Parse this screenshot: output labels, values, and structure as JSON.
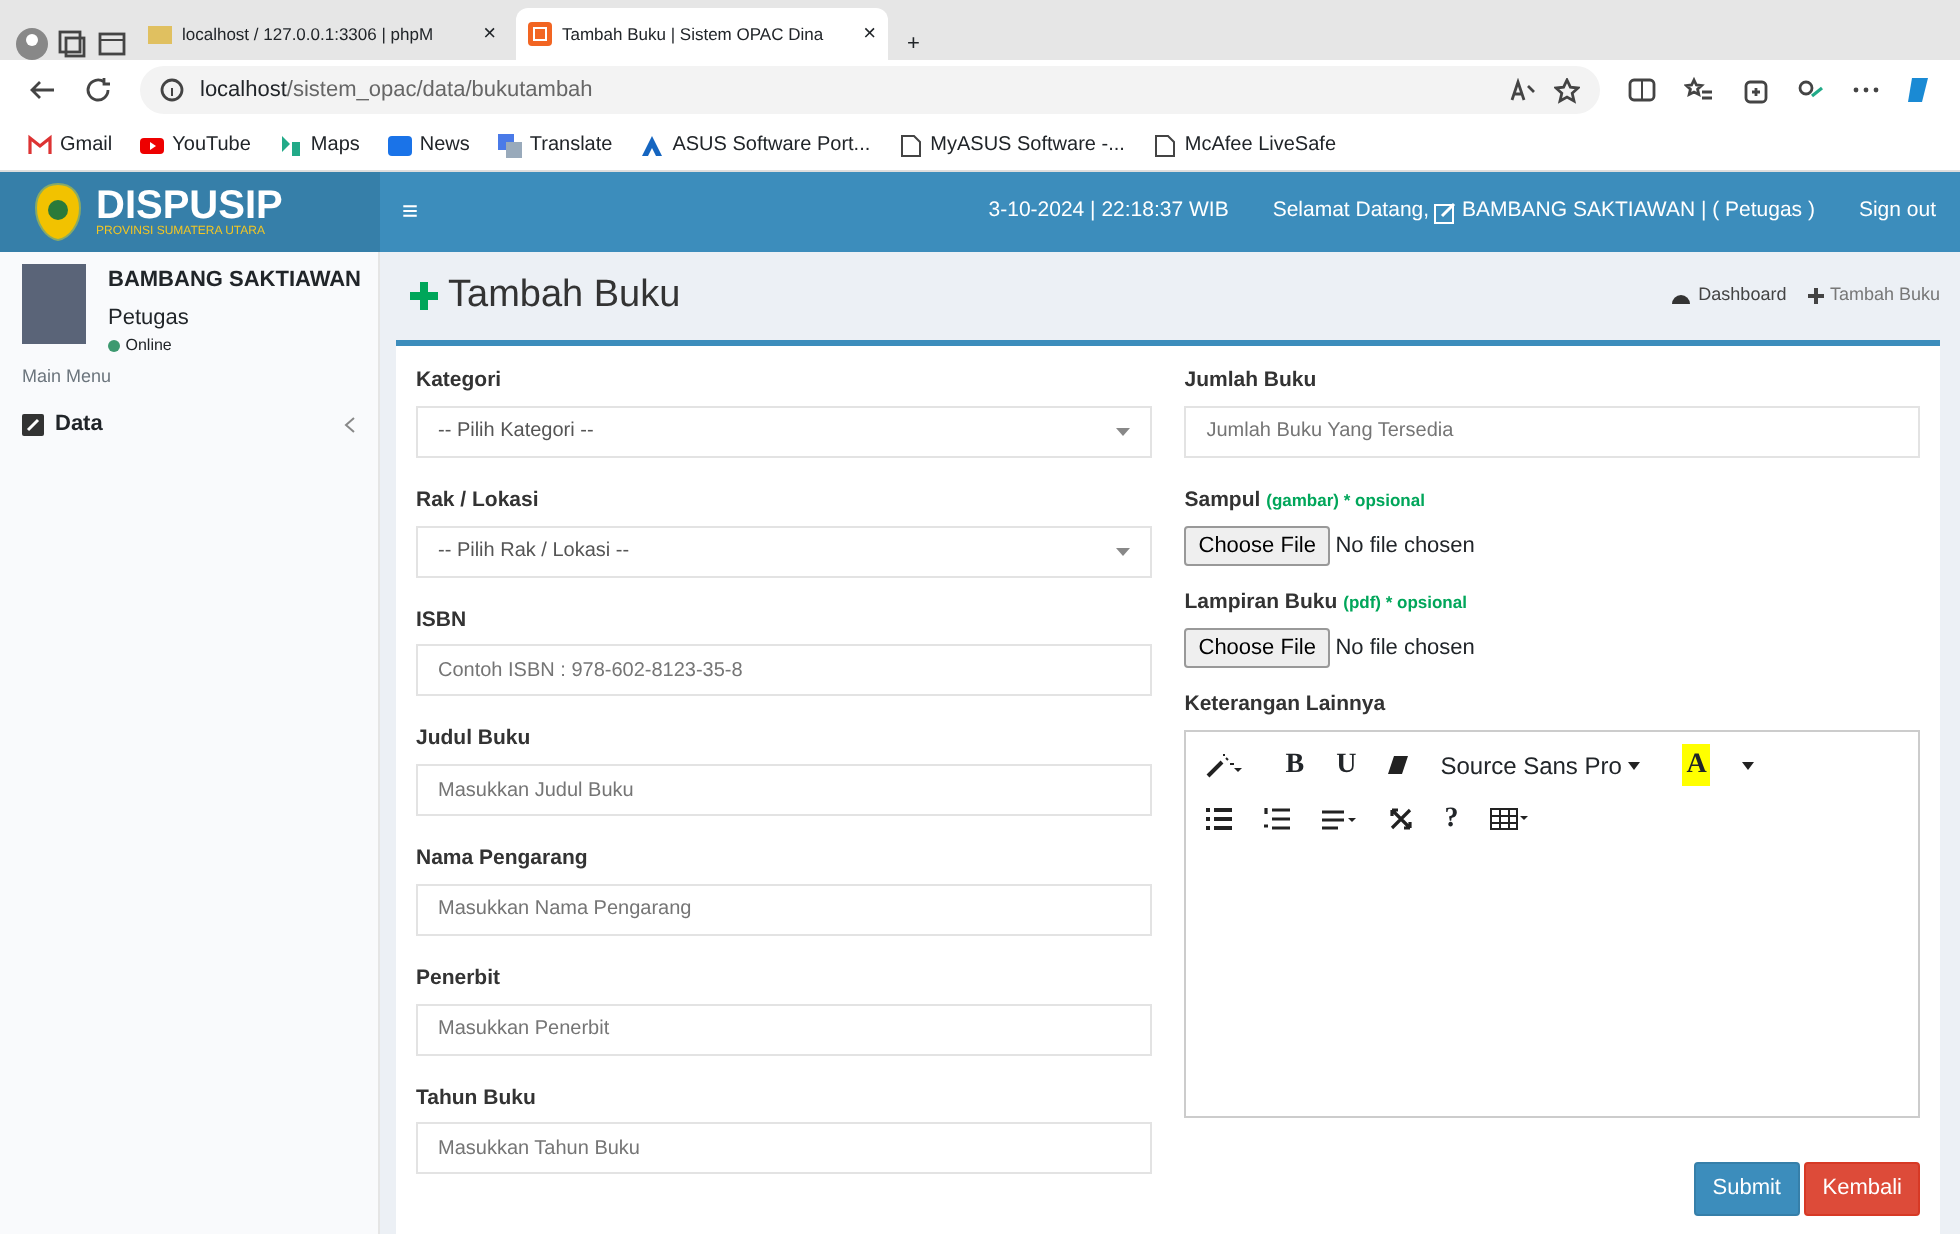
{
  "browser": {
    "tabs": [
      {
        "title": "localhost / 127.0.0.1:3306 | phpM",
        "close": "×",
        "selected": false
      },
      {
        "title": "Tambah Buku | Sistem OPAC Dina",
        "close": "×",
        "selected": true
      }
    ],
    "new_tab": "+",
    "url_host": "localhost",
    "url_path": "/sistem_opac/data/bukutambah",
    "bookmarks": [
      "Gmail",
      "YouTube",
      "Maps",
      "News",
      "Translate",
      "ASUS Software Port...",
      "MyASUS Software -...",
      "McAfee LiveSafe"
    ]
  },
  "header": {
    "logo_title": "DISPUSIP",
    "logo_subtitle": "PROVINSI SUMATERA UTARA",
    "menu_toggle": "≡",
    "datetime": "3-10-2024 | 22:18:37 WIB",
    "greeting": "Selamat Datang,",
    "user": "BAMBANG SAKTIAWAN | ( Petugas )",
    "signout": "Sign out"
  },
  "sidebar": {
    "user_name": "BAMBANG SAKTIAWAN",
    "role": "Petugas",
    "status": "Online",
    "menu_header": "Main Menu",
    "items": [
      {
        "label": "Data",
        "selected": false
      }
    ]
  },
  "page": {
    "title": "Tambah Buku",
    "breadcrumbs": [
      "Dashboard",
      "Tambah Buku"
    ]
  },
  "left_fields": [
    {
      "label": "Kategori",
      "kind": "select",
      "placeholder": "-- Pilih Kategori --"
    },
    {
      "label": "Rak / Lokasi",
      "kind": "select",
      "placeholder": "-- Pilih Rak / Lokasi --"
    },
    {
      "label": "ISBN",
      "kind": "text",
      "placeholder": "Contoh ISBN : 978-602-8123-35-8"
    },
    {
      "label": "Judul Buku",
      "kind": "text",
      "placeholder": "Masukkan Judul Buku"
    },
    {
      "label": "Nama Pengarang",
      "kind": "text",
      "placeholder": "Masukkan Nama Pengarang"
    },
    {
      "label": "Penerbit",
      "kind": "text",
      "placeholder": "Masukkan Penerbit"
    },
    {
      "label": "Tahun Buku",
      "kind": "text",
      "placeholder": "Masukkan Tahun Buku"
    }
  ],
  "right_fields": [
    {
      "label": "Jumlah Buku",
      "kind": "text",
      "placeholder": "Jumlah Buku Yang Tersedia"
    },
    {
      "label": "Sampul",
      "note": "(gambar) * opsional",
      "kind": "file",
      "button": "Choose File",
      "status": "No file chosen"
    },
    {
      "label": "Lampiran Buku",
      "note": "(pdf) * opsional",
      "kind": "file",
      "button": "Choose File",
      "status": "No file chosen"
    },
    {
      "label": "Keterangan Lainnya",
      "kind": "editor",
      "bold": "B",
      "underline": "U",
      "font": "Source Sans Pro",
      "highlight": "A",
      "help": "?"
    }
  ],
  "buttons": [
    {
      "label": "Submit",
      "kind": "primary"
    },
    {
      "label": "Kembali",
      "kind": "danger"
    }
  ]
}
